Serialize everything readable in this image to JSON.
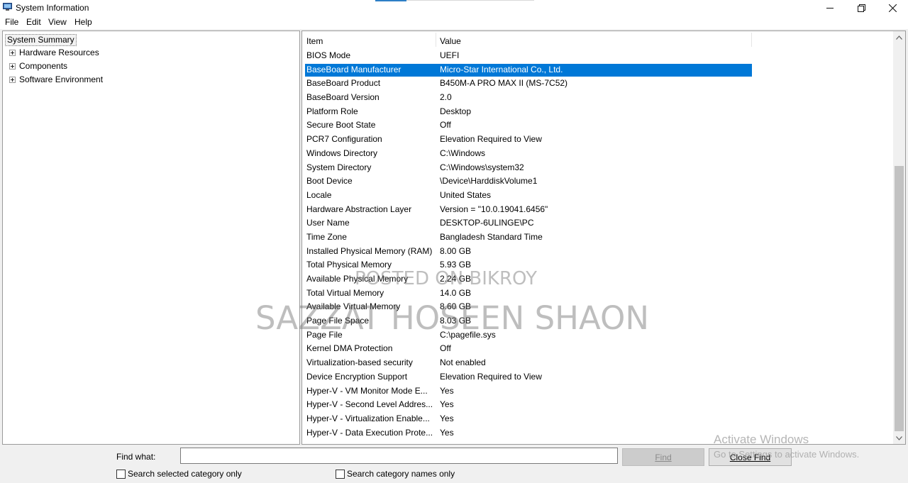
{
  "window": {
    "title": "System Information"
  },
  "menu": [
    "File",
    "Edit",
    "View",
    "Help"
  ],
  "tree": {
    "root": "System Summary",
    "children": [
      "Hardware Resources",
      "Components",
      "Software Environment"
    ]
  },
  "list": {
    "columns": [
      "Item",
      "Value"
    ],
    "selected_index": 1,
    "rows": [
      {
        "item": "BIOS Mode",
        "value": "UEFI"
      },
      {
        "item": "BaseBoard Manufacturer",
        "value": "Micro-Star International Co., Ltd."
      },
      {
        "item": "BaseBoard Product",
        "value": "B450M-A PRO MAX II (MS-7C52)"
      },
      {
        "item": "BaseBoard Version",
        "value": "2.0"
      },
      {
        "item": "Platform Role",
        "value": "Desktop"
      },
      {
        "item": "Secure Boot State",
        "value": "Off"
      },
      {
        "item": "PCR7 Configuration",
        "value": "Elevation Required to View"
      },
      {
        "item": "Windows Directory",
        "value": "C:\\Windows"
      },
      {
        "item": "System Directory",
        "value": "C:\\Windows\\system32"
      },
      {
        "item": "Boot Device",
        "value": "\\Device\\HarddiskVolume1"
      },
      {
        "item": "Locale",
        "value": "United States"
      },
      {
        "item": "Hardware Abstraction Layer",
        "value": "Version = \"10.0.19041.6456\""
      },
      {
        "item": "User Name",
        "value": "DESKTOP-6ULINGE\\PC"
      },
      {
        "item": "Time Zone",
        "value": "Bangladesh Standard Time"
      },
      {
        "item": "Installed Physical Memory (RAM)",
        "value": "8.00 GB"
      },
      {
        "item": "Total Physical Memory",
        "value": "5.93 GB"
      },
      {
        "item": "Available Physical Memory",
        "value": "2.24 GB"
      },
      {
        "item": "Total Virtual Memory",
        "value": "14.0 GB"
      },
      {
        "item": "Available Virtual Memory",
        "value": "8.60 GB"
      },
      {
        "item": "Page File Space",
        "value": "8.03 GB"
      },
      {
        "item": "Page File",
        "value": "C:\\pagefile.sys"
      },
      {
        "item": "Kernel DMA Protection",
        "value": "Off"
      },
      {
        "item": "Virtualization-based security",
        "value": "Not enabled"
      },
      {
        "item": "Device Encryption Support",
        "value": "Elevation Required to View"
      },
      {
        "item": "Hyper-V - VM Monitor Mode E...",
        "value": "Yes"
      },
      {
        "item": "Hyper-V - Second Level Addres...",
        "value": "Yes"
      },
      {
        "item": "Hyper-V - Virtualization Enable...",
        "value": "Yes"
      },
      {
        "item": "Hyper-V - Data Execution Prote...",
        "value": "Yes"
      }
    ]
  },
  "find": {
    "label": "Find what:",
    "value": "",
    "find_button": "Find",
    "close_button": "Close Find",
    "checkbox_selected": "Search selected category only",
    "checkbox_names": "Search category names only"
  },
  "overlays": {
    "watermark_line1": "POSTED ON BIKROY",
    "watermark_line2": "SAZZAT HOSEEN SHAON",
    "activate_title": "Activate Windows",
    "activate_sub": "Go to Settings to activate Windows."
  },
  "colors": {
    "selection": "#0078d7",
    "accent": "#2d7fc6"
  },
  "icons": [
    "app-icon",
    "minimize-icon",
    "restore-icon",
    "close-icon",
    "tree-expand-icon",
    "scroll-up-icon",
    "scroll-down-icon"
  ]
}
